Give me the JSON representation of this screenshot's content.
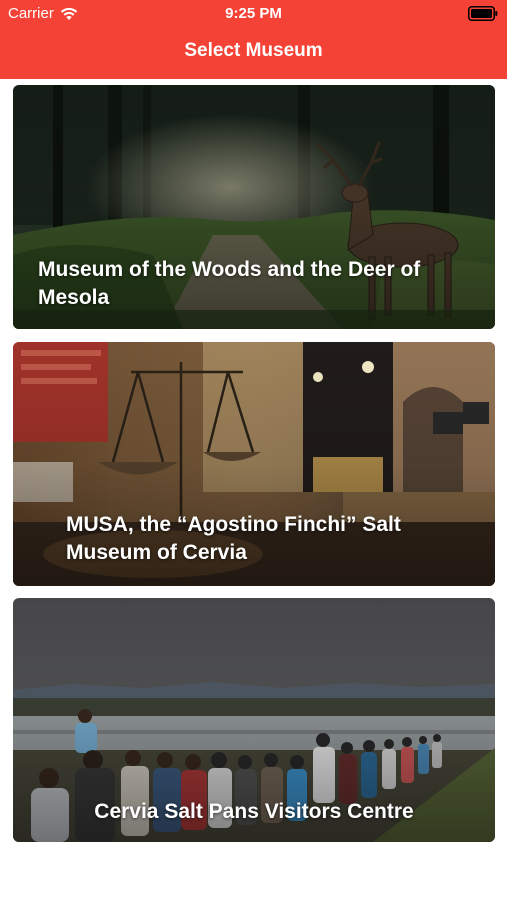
{
  "status_bar": {
    "carrier": "Carrier",
    "time": "9:25 PM",
    "wifi_icon": "wifi-icon",
    "battery_icon": "battery-full-icon"
  },
  "nav": {
    "title": "Select Museum",
    "background_color": "#f44336"
  },
  "museums": [
    {
      "title": "Museum of the Woods and the Deer of Mesola",
      "image": "deer in forest clearing"
    },
    {
      "title": "MUSA, the “Agostino Finchi” Salt Museum of Cervia",
      "image": "museum interior with antique scales"
    },
    {
      "title": "Cervia Salt Pans Visitors Centre",
      "image": "visitors walking along salt pans"
    }
  ]
}
